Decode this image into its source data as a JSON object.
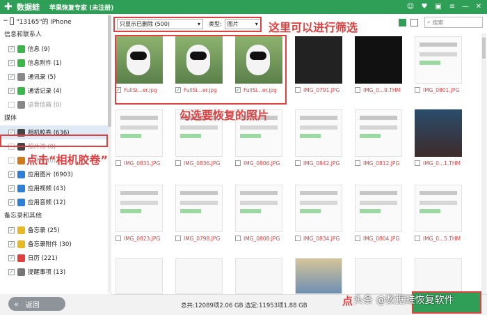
{
  "app": {
    "logo_text": "数据蛙",
    "title": "苹果恢复专家 (未注册)"
  },
  "device": {
    "name": "\"13165\"的 iPhone"
  },
  "sidebar": {
    "sections": [
      {
        "label": "信息和联系人",
        "items": [
          {
            "label": "信息 (9)",
            "icon_color": "#3cb54a",
            "icon": "message-icon"
          },
          {
            "label": "信息附件 (1)",
            "icon_color": "#3cb54a",
            "icon": "attachment-icon"
          },
          {
            "label": "通讯录 (5)",
            "icon_color": "#8a8a8a",
            "icon": "contacts-icon"
          },
          {
            "label": "通话记录 (4)",
            "icon_color": "#3cb54a",
            "icon": "phone-icon"
          },
          {
            "label": "语音信箱 (0)",
            "icon_color": "#888888",
            "icon": "voicemail-icon",
            "disabled": true
          }
        ]
      },
      {
        "label": "媒体",
        "items": [
          {
            "label": "相机胶卷 (636)",
            "icon_color": "#444444",
            "icon": "camera-icon",
            "selected": true
          },
          {
            "label": "照片流 (0)",
            "icon_color": "#444444",
            "icon": "camera-icon",
            "disabled": true
          },
          {
            "label": "照片库 (0)",
            "icon_color": "#cc7a1a",
            "icon": "photo-library-icon",
            "disabled": true
          },
          {
            "label": "应用图片 (6903)",
            "icon_color": "#2f7fd6",
            "icon": "app-photo-icon"
          },
          {
            "label": "应用视频 (43)",
            "icon_color": "#2f7fd6",
            "icon": "app-video-icon"
          },
          {
            "label": "应用音频 (12)",
            "icon_color": "#2f7fd6",
            "icon": "app-audio-icon"
          }
        ]
      },
      {
        "label": "备忘录和其他",
        "items": [
          {
            "label": "备忘录 (25)",
            "icon_color": "#e8b923",
            "icon": "notes-icon"
          },
          {
            "label": "备忘录附件 (30)",
            "icon_color": "#e8b923",
            "icon": "notes-attachment-icon"
          },
          {
            "label": "日历 (221)",
            "icon_color": "#e04040",
            "icon": "calendar-icon"
          },
          {
            "label": "提醒事项 (13)",
            "icon_color": "#777777",
            "icon": "reminders-icon"
          }
        ]
      }
    ]
  },
  "toolbar": {
    "filter_value": "只显示已删除 (500)",
    "type_label": "类型:",
    "type_value": "图片",
    "search_placeholder": "搜索"
  },
  "files": [
    {
      "name": "FullSi...er.jpg",
      "checked": true,
      "deleted": true
    },
    {
      "name": "FullSi...er.jpg",
      "checked": true,
      "deleted": true
    },
    {
      "name": "FullSi...er.jpg",
      "checked": true,
      "deleted": true
    },
    {
      "name": "IMG_0791.JPG",
      "checked": false,
      "deleted": true
    },
    {
      "name": "IMG_0...9.THM",
      "checked": false,
      "deleted": true
    },
    {
      "name": "IMG_0801.JPG",
      "checked": false,
      "deleted": true
    },
    {
      "name": "IMG_0831.JPG",
      "checked": false,
      "deleted": true
    },
    {
      "name": "IMG_0836.JPG",
      "checked": false,
      "deleted": true
    },
    {
      "name": "IMG_0806.JPG",
      "checked": false,
      "deleted": true
    },
    {
      "name": "IMG_0842.JPG",
      "checked": false,
      "deleted": true
    },
    {
      "name": "IMG_0812.JPG",
      "checked": false,
      "deleted": true
    },
    {
      "name": "IMG_0...1.THM",
      "checked": false,
      "deleted": true
    },
    {
      "name": "IMG_0823.JPG",
      "checked": false,
      "deleted": true
    },
    {
      "name": "IMG_0798.JPG",
      "checked": false,
      "deleted": true
    },
    {
      "name": "IMG_0808.JPG",
      "checked": false,
      "deleted": true
    },
    {
      "name": "IMG_0834.JPG",
      "checked": false,
      "deleted": true
    },
    {
      "name": "IMG_0804.JPG",
      "checked": false,
      "deleted": true
    },
    {
      "name": "IMG_0...5.THM",
      "checked": false,
      "deleted": true
    }
  ],
  "footer": {
    "back_label": "返回",
    "stats": "总共:12089项2.06 GB 选定:11953项1.88 GB",
    "recover_prefix": "点"
  },
  "annotations": {
    "filter": "这里可以进行筛选",
    "select": "勾选要恢复的照片",
    "click": "点击“相机胶卷”"
  },
  "watermark": "头条 @数据蛙恢复软件",
  "colors": {
    "brand": "#2f9e56",
    "annotation": "#e04040",
    "deleted_text": "#e04040"
  }
}
